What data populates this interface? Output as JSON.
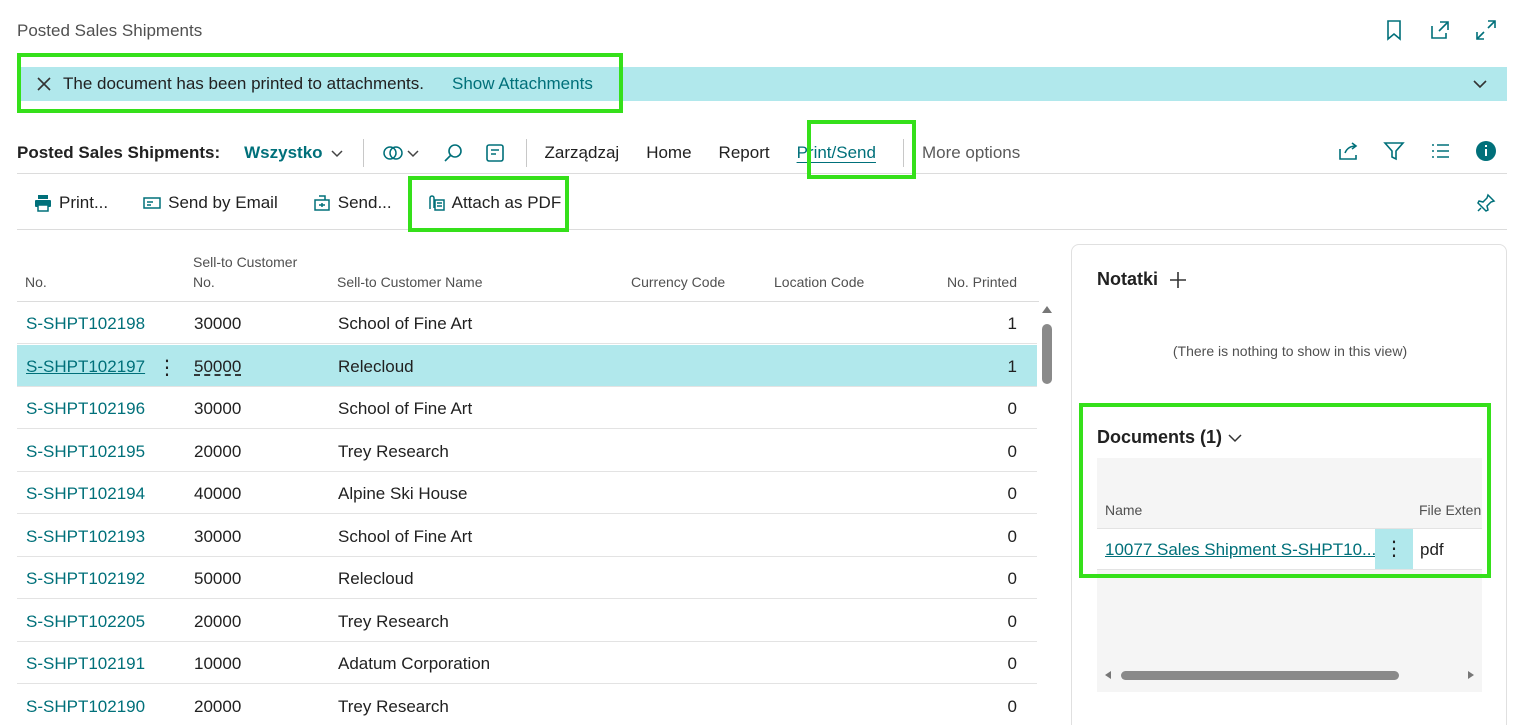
{
  "page": {
    "title": "Posted Sales Shipments"
  },
  "banner": {
    "message": "The document has been printed to attachments.",
    "link": "Show Attachments"
  },
  "actionbar": {
    "title": "Posted Sales Shipments:",
    "view": "Wszystko",
    "menus": [
      "Zarządzaj",
      "Home",
      "Report",
      "Print/Send"
    ],
    "active_menu": "Print/Send",
    "more": "More options"
  },
  "subbar": {
    "print": "Print...",
    "email": "Send by Email",
    "send": "Send...",
    "attach": "Attach as PDF"
  },
  "list": {
    "columns": {
      "no": "No.",
      "cust_no_1": "Sell-to Customer",
      "cust_no_2": "No.",
      "cust_name": "Sell-to Customer Name",
      "currency": "Currency Code",
      "location": "Location Code",
      "printed": "No. Printed"
    },
    "rows": [
      {
        "no": "S-SHPT102198",
        "cust": "30000",
        "name": "School of Fine Art",
        "printed": "1"
      },
      {
        "no": "S-SHPT102197",
        "cust": "50000",
        "name": "Relecloud",
        "printed": "1"
      },
      {
        "no": "S-SHPT102196",
        "cust": "30000",
        "name": "School of Fine Art",
        "printed": "0"
      },
      {
        "no": "S-SHPT102195",
        "cust": "20000",
        "name": "Trey Research",
        "printed": "0"
      },
      {
        "no": "S-SHPT102194",
        "cust": "40000",
        "name": "Alpine Ski House",
        "printed": "0"
      },
      {
        "no": "S-SHPT102193",
        "cust": "30000",
        "name": "School of Fine Art",
        "printed": "0"
      },
      {
        "no": "S-SHPT102192",
        "cust": "50000",
        "name": "Relecloud",
        "printed": "0"
      },
      {
        "no": "S-SHPT102205",
        "cust": "20000",
        "name": "Trey Research",
        "printed": "0"
      },
      {
        "no": "S-SHPT102191",
        "cust": "10000",
        "name": "Adatum Corporation",
        "printed": "0"
      },
      {
        "no": "S-SHPT102190",
        "cust": "20000",
        "name": "Trey Research",
        "printed": "0"
      }
    ],
    "selected_index": 1,
    "row_menu": "⋮"
  },
  "factbox": {
    "notes_title": "Notatki",
    "notes_empty": "(There is nothing to show in this view)",
    "docs_title": "Documents (1)",
    "docs_columns": {
      "name": "Name",
      "ext": "File Exten"
    },
    "docs_row": {
      "name": "10077 Sales Shipment S-SHPT10...",
      "ext": "pdf"
    },
    "row_menu": "⋮"
  },
  "colors": {
    "accent": "#00707a",
    "selection": "#b1e8ec",
    "highlight": "#35e01a"
  }
}
